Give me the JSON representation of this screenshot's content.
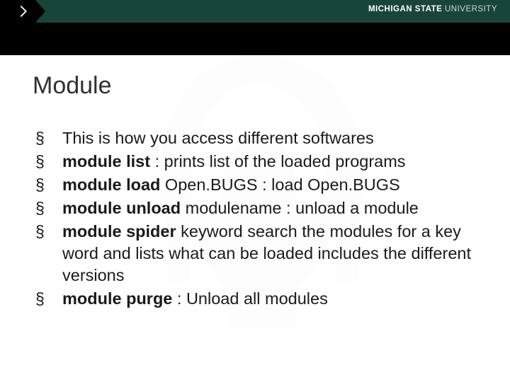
{
  "header": {
    "brand_bold": "MICHIGAN STATE",
    "brand_light": " UNIVERSITY"
  },
  "slide": {
    "title": "Module",
    "bullets": [
      {
        "parts": [
          {
            "text": "This is how you access different softwares",
            "bold": false
          }
        ]
      },
      {
        "parts": [
          {
            "text": "module list",
            "bold": true
          },
          {
            "text": " :   prints list of the loaded programs",
            "bold": false
          }
        ]
      },
      {
        "parts": [
          {
            "text": "module load",
            "bold": true
          },
          {
            "text": " Open.BUGS  :   load Open.BUGS",
            "bold": false
          }
        ]
      },
      {
        "parts": [
          {
            "text": "module unload",
            "bold": true
          },
          {
            "text": " modulename : unload a module",
            "bold": false
          }
        ]
      },
      {
        "parts": [
          {
            "text": "module spider",
            "bold": true
          },
          {
            "text": " keyword          search the modules for a key word and lists what can be loaded includes the different versions",
            "bold": false
          }
        ]
      },
      {
        "parts": [
          {
            "text": "module purge",
            "bold": true
          },
          {
            "text": " : Unload all modules",
            "bold": false
          }
        ]
      }
    ]
  }
}
